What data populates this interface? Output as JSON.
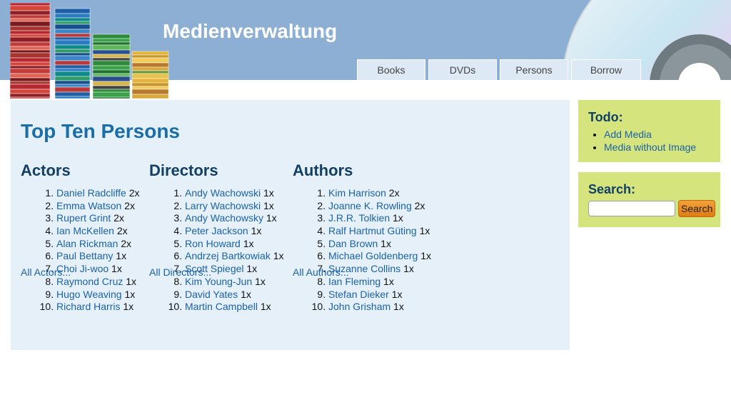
{
  "header": {
    "title": "Medienverwaltung",
    "logo_icon": "books-stack-icon",
    "decor_icon": "cd-disc-icon",
    "tabs": [
      {
        "label": "Books"
      },
      {
        "label": "DVDs"
      },
      {
        "label": "Persons"
      },
      {
        "label": "Borrow"
      }
    ]
  },
  "main": {
    "title": "Top Ten Persons",
    "columns": [
      {
        "heading": "Actors",
        "items": [
          {
            "name": "Daniel Radcliffe",
            "count": "2x"
          },
          {
            "name": "Emma Watson",
            "count": "2x"
          },
          {
            "name": "Rupert Grint",
            "count": "2x"
          },
          {
            "name": "Ian McKellen",
            "count": "2x"
          },
          {
            "name": "Alan Rickman",
            "count": "2x"
          },
          {
            "name": "Paul Bettany",
            "count": "1x"
          },
          {
            "name": "Choi Ji-woo",
            "count": "1x"
          },
          {
            "name": "Raymond Cruz",
            "count": "1x"
          },
          {
            "name": "Hugo Weaving",
            "count": "1x"
          },
          {
            "name": "Richard Harris",
            "count": "1x"
          }
        ],
        "all_link": "All Actors..."
      },
      {
        "heading": "Directors",
        "items": [
          {
            "name": "Andy Wachowski",
            "count": "1x"
          },
          {
            "name": "Larry Wachowski",
            "count": "1x"
          },
          {
            "name": "Andy Wachowsky",
            "count": "1x"
          },
          {
            "name": "Peter Jackson",
            "count": "1x"
          },
          {
            "name": "Ron Howard",
            "count": "1x"
          },
          {
            "name": "Andrzej Bartkowiak",
            "count": "1x"
          },
          {
            "name": "Scott Spiegel",
            "count": "1x"
          },
          {
            "name": "Kim Young-Jun",
            "count": "1x"
          },
          {
            "name": "David Yates",
            "count": "1x"
          },
          {
            "name": "Martin Campbell",
            "count": "1x"
          }
        ],
        "all_link": "All Directors..."
      },
      {
        "heading": "Authors",
        "items": [
          {
            "name": "Kim Harrison",
            "count": "2x"
          },
          {
            "name": "Joanne K. Rowling",
            "count": "2x"
          },
          {
            "name": "J.R.R. Tolkien",
            "count": "1x"
          },
          {
            "name": "Ralf Hartmut Güting",
            "count": "1x"
          },
          {
            "name": "Dan Brown",
            "count": "1x"
          },
          {
            "name": "Michael Goldenberg",
            "count": "1x"
          },
          {
            "name": "Suzanne Collins",
            "count": "1x"
          },
          {
            "name": "Ian Fleming",
            "count": "1x"
          },
          {
            "name": "Stefan Dieker",
            "count": "1x"
          },
          {
            "name": "John Grisham",
            "count": "1x"
          }
        ],
        "all_link": "All Authors..."
      }
    ]
  },
  "sidebar": {
    "todo": {
      "heading": "Todo:",
      "items": [
        {
          "label": "Add Media"
        },
        {
          "label": "Media without Image"
        }
      ]
    },
    "search": {
      "heading": "Search:",
      "input_value": "",
      "button_label": "Search"
    }
  },
  "colors": {
    "header_bg": "#8eafd4",
    "main_bg": "#e6f0f8",
    "sidebar_bg": "#d6e47e",
    "link": "#1a62a8",
    "title": "#1a6ea8",
    "button": "#e88a1a"
  }
}
